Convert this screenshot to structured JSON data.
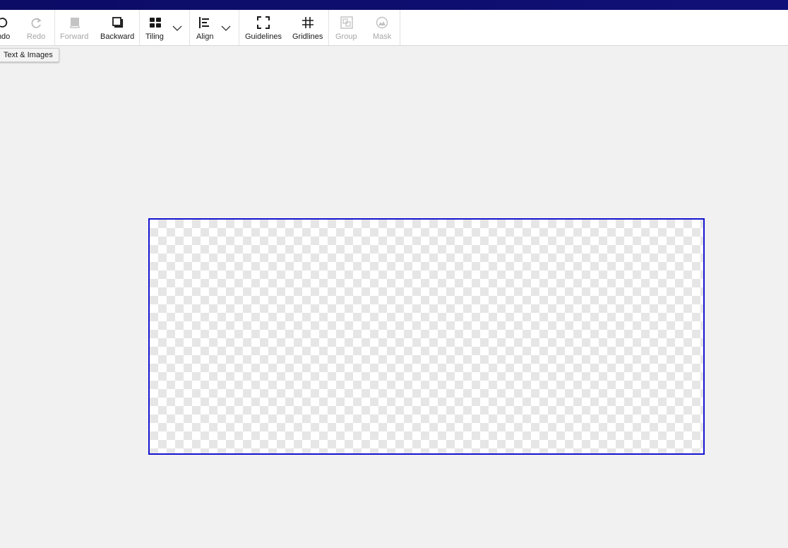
{
  "toolbar": {
    "undo_label": "Undo",
    "redo_label": "Redo",
    "forward_label": "Forward",
    "backward_label": "Backward",
    "tiling_label": "Tiling",
    "align_label": "Align",
    "guidelines_label": "Guidelines",
    "gridlines_label": "Gridlines",
    "group_label": "Group",
    "mask_label": "Mask"
  },
  "tab_chip": {
    "label": "Text & Images"
  },
  "icons": {
    "undo": "undo-icon",
    "redo": "redo-icon",
    "forward": "bring-forward-icon",
    "backward": "send-backward-icon",
    "tiling": "tiling-grid-icon",
    "align": "align-left-icon",
    "guidelines": "guidelines-frame-icon",
    "gridlines": "gridlines-hash-icon",
    "group": "group-icon",
    "mask": "mask-icon"
  },
  "colors": {
    "titlebar": "#0c0c66",
    "canvas_border": "#1414d2",
    "disabled_text": "#a6a6a6"
  }
}
